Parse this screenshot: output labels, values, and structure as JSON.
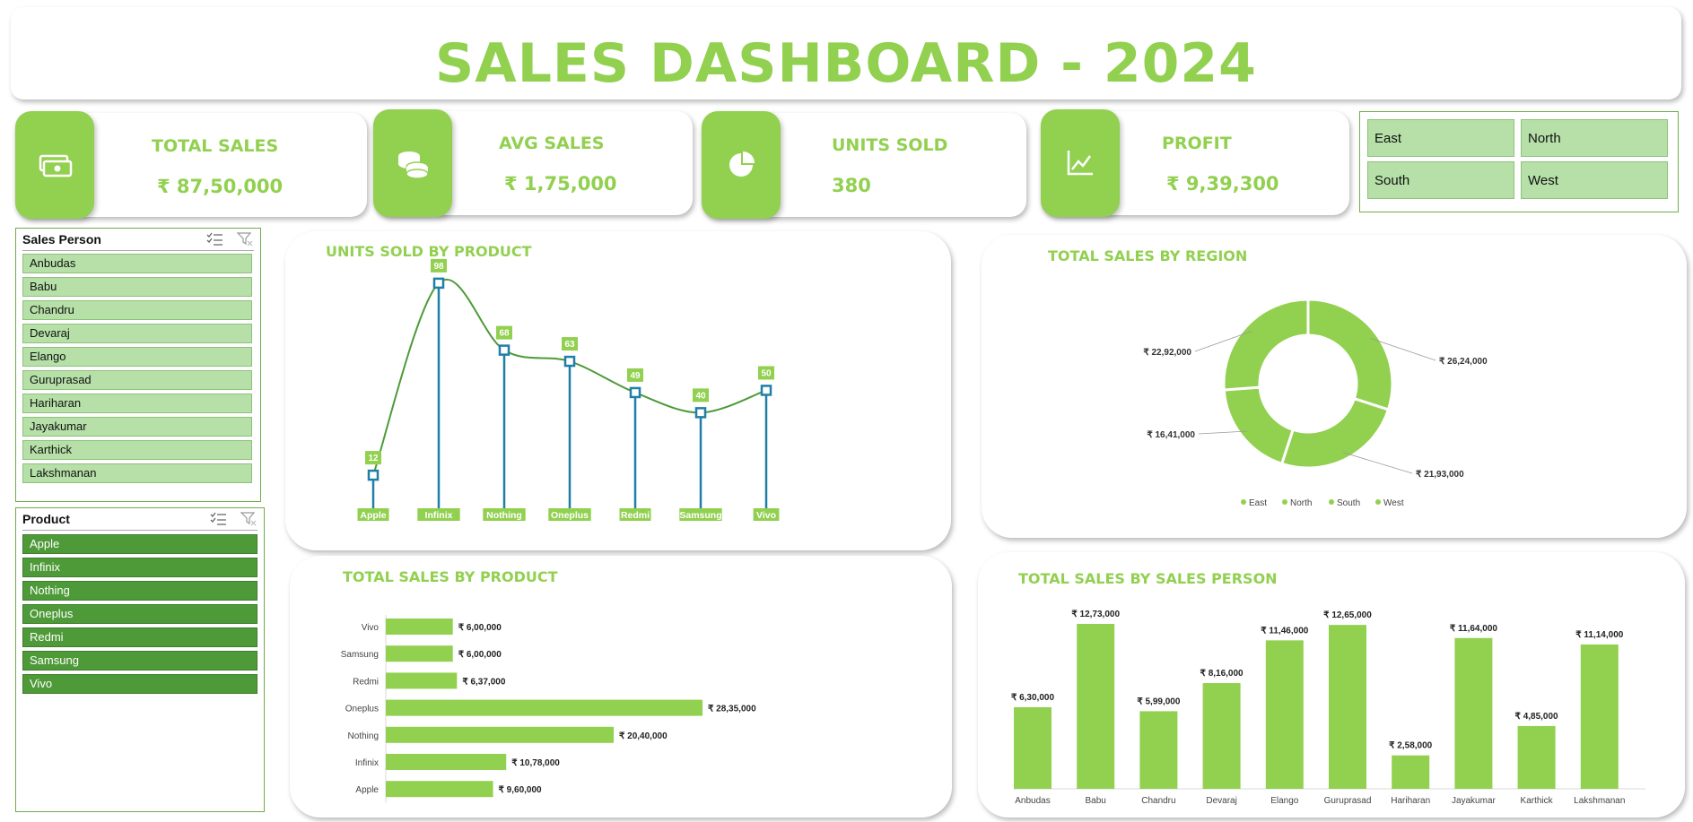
{
  "title": "SALES DASHBOARD - 2024",
  "colors": {
    "accent": "#92D050",
    "stem": "#1F7FA6",
    "line": "#4E9A39",
    "slicer_light": "#B6E0A8",
    "slicer_dark": "#4E9A39"
  },
  "kpis": [
    {
      "label": "TOTAL SALES",
      "value": "₹ 87,50,000",
      "icon": "cash-icon"
    },
    {
      "label": "AVG SALES",
      "value": "₹ 1,75,000",
      "icon": "coins-icon"
    },
    {
      "label": "UNITS SOLD",
      "value": "380",
      "icon": "pie-chart-icon"
    },
    {
      "label": "PROFIT",
      "value": "₹ 9,39,300",
      "icon": "trend-chart-icon"
    }
  ],
  "region_slicer": {
    "items": [
      "East",
      "North",
      "South",
      "West"
    ]
  },
  "sales_person_slicer": {
    "header": "Sales Person",
    "items": [
      "Anbudas",
      "Babu",
      "Chandru",
      "Devaraj",
      "Elango",
      "Guruprasad",
      "Hariharan",
      "Jayakumar",
      "Karthick",
      "Lakshmanan"
    ]
  },
  "product_slicer": {
    "header": "Product",
    "items": [
      "Apple",
      "Infinix",
      "Nothing",
      "Oneplus",
      "Redmi",
      "Samsung",
      "Vivo"
    ]
  },
  "chart_data": [
    {
      "type": "line",
      "title": "UNITS SOLD BY PRODUCT",
      "categories": [
        "Apple",
        "Infinix",
        "Nothing",
        "Oneplus",
        "Redmi",
        "Samsung",
        "Vivo"
      ],
      "values": [
        12,
        98,
        68,
        63,
        49,
        40,
        50
      ],
      "labels": [
        "12",
        "98",
        "68",
        "63",
        "49",
        "40",
        "50"
      ],
      "ylim": [
        0,
        110
      ]
    },
    {
      "type": "pie",
      "title": "TOTAL SALES BY REGION",
      "categories": [
        "East",
        "North",
        "South",
        "West"
      ],
      "values": [
        2624000,
        2193000,
        1641000,
        2292000
      ],
      "labels": [
        "₹ 26,24,000",
        "₹ 21,93,000",
        "₹ 16,41,000",
        "₹ 22,92,000"
      ],
      "legend": "bottom"
    },
    {
      "type": "bar",
      "title": "TOTAL SALES BY PRODUCT",
      "orientation": "horizontal",
      "categories": [
        "Vivo",
        "Samsung",
        "Redmi",
        "Oneplus",
        "Nothing",
        "Infinix",
        "Apple"
      ],
      "values": [
        600000,
        600000,
        637000,
        2835000,
        2040000,
        1078000,
        960000
      ],
      "labels": [
        "₹ 6,00,000",
        "₹ 6,00,000",
        "₹ 6,37,000",
        "₹ 28,35,000",
        "₹ 20,40,000",
        "₹ 10,78,000",
        "₹ 9,60,000"
      ]
    },
    {
      "type": "bar",
      "title": "TOTAL SALES BY SALES PERSON",
      "categories": [
        "Anbudas",
        "Babu",
        "Chandru",
        "Devaraj",
        "Elango",
        "Guruprasad",
        "Hariharan",
        "Jayakumar",
        "Karthick",
        "Lakshmanan"
      ],
      "values": [
        630000,
        1273000,
        599000,
        816000,
        1146000,
        1265000,
        258000,
        1164000,
        485000,
        1114000
      ],
      "labels": [
        "₹ 6,30,000",
        "₹ 12,73,000",
        "₹ 5,99,000",
        "₹ 8,16,000",
        "₹ 11,46,000",
        "₹ 12,65,000",
        "₹ 2,58,000",
        "₹ 11,64,000",
        "₹ 4,85,000",
        "₹ 11,14,000"
      ]
    }
  ]
}
